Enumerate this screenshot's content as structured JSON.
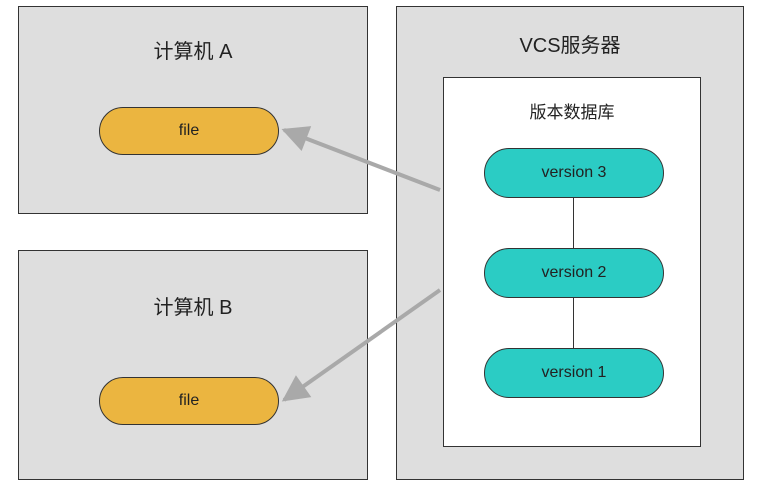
{
  "computerA": {
    "title": "计算机 A",
    "file_label": "file"
  },
  "computerB": {
    "title": "计算机 B",
    "file_label": "file"
  },
  "server": {
    "title": "VCS服务器",
    "db_title": "版本数据库",
    "versions": {
      "v3": "version 3",
      "v2": "version 2",
      "v1": "version 1"
    }
  }
}
